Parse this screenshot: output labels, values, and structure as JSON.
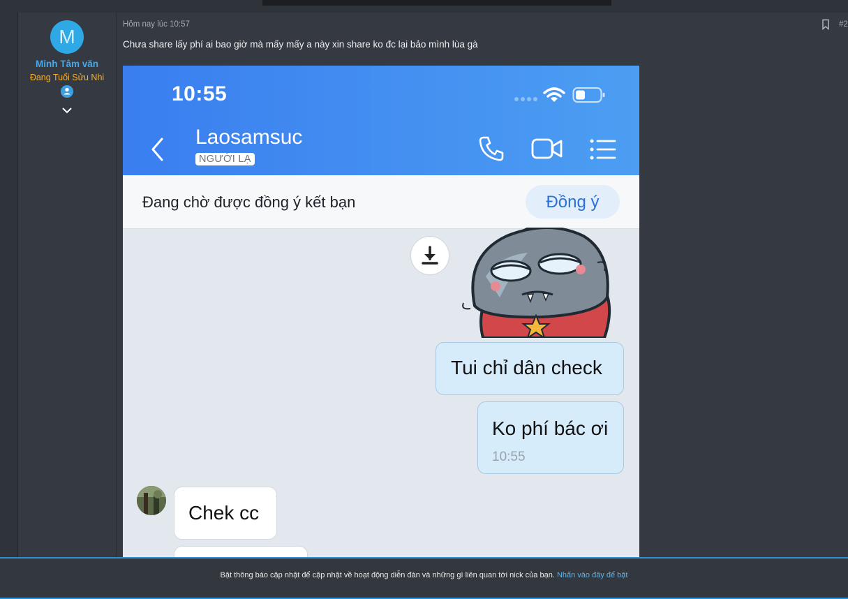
{
  "post": {
    "avatar_letter": "M",
    "username": "Minh Tâm văn",
    "user_title": "Đang Tuổi Sửu Nhi",
    "timestamp": "Hôm nay lúc 10:57",
    "post_number": "#2",
    "message": "Chưa share lấy phí ai bao giờ mà mấy mấy a này xin share ko đc lại bảo mình lùa gà"
  },
  "screenshot": {
    "status_time": "10:55",
    "contact_name": "Laosamsuc",
    "contact_tag": "NGƯỜI LẠ",
    "friend_pending_text": "Đang chờ được đồng ý kết bạn",
    "accept_button": "Đồng ý",
    "messages": [
      {
        "side": "out",
        "text": "Tui chỉ dân check"
      },
      {
        "side": "out",
        "text": "Ko phí bác ơi",
        "time": "10:55"
      },
      {
        "side": "in",
        "text": "Chek cc"
      }
    ]
  },
  "notice": {
    "text": "Bật thông báo cập nhật để cập nhật về hoạt động diễn đàn và những gì liên quan tới nick của bạn.",
    "link": "Nhấn vào đây để bật"
  },
  "colors": {
    "page_bg": "#2f333a",
    "post_bg": "#353a42",
    "username": "#47a7eb",
    "user_title": "#f2b134",
    "zalo_header": "#3a7ef0",
    "outgoing_bubble": "#d7ecfb",
    "notice_border": "#2f8fd5"
  }
}
